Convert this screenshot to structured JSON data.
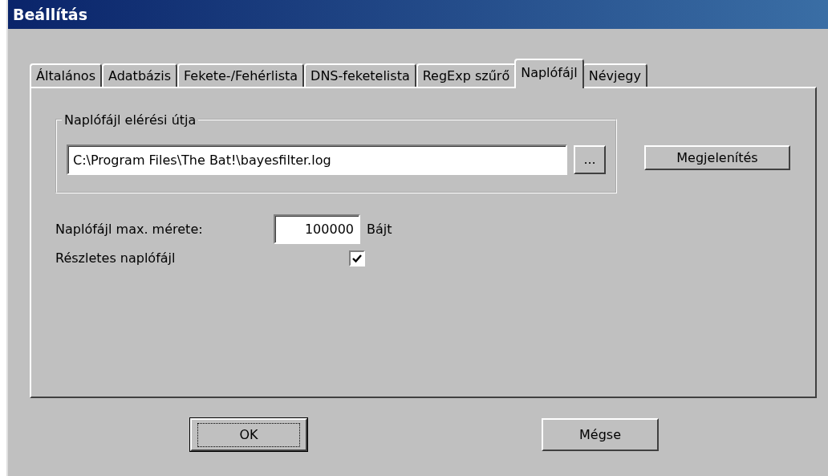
{
  "window": {
    "title": "Beállítás"
  },
  "tabs": [
    {
      "label": "Általános",
      "selected": false
    },
    {
      "label": "Adatbázis",
      "selected": false
    },
    {
      "label": "Fekete-/Fehérlista",
      "selected": false
    },
    {
      "label": "DNS-feketelista",
      "selected": false
    },
    {
      "label": "RegExp szűrő",
      "selected": false
    },
    {
      "label": "Naplófájl",
      "selected": true
    },
    {
      "label": "Névjegy",
      "selected": false
    }
  ],
  "log_path_group": {
    "label": "Naplófájl elérési útja",
    "path": "C:\\Program Files\\The Bat!\\bayesfilter.log",
    "browse_button": "...",
    "view_button": "Megjelenítés"
  },
  "max_size": {
    "label": "Naplófájl max. mérete:",
    "value": "100000",
    "unit": "Bájt"
  },
  "verbose_log": {
    "label": "Részletes naplófájl",
    "checked": true
  },
  "buttons": [
    {
      "label": "OK",
      "default": true
    },
    {
      "label": "Mégse",
      "default": false
    }
  ]
}
